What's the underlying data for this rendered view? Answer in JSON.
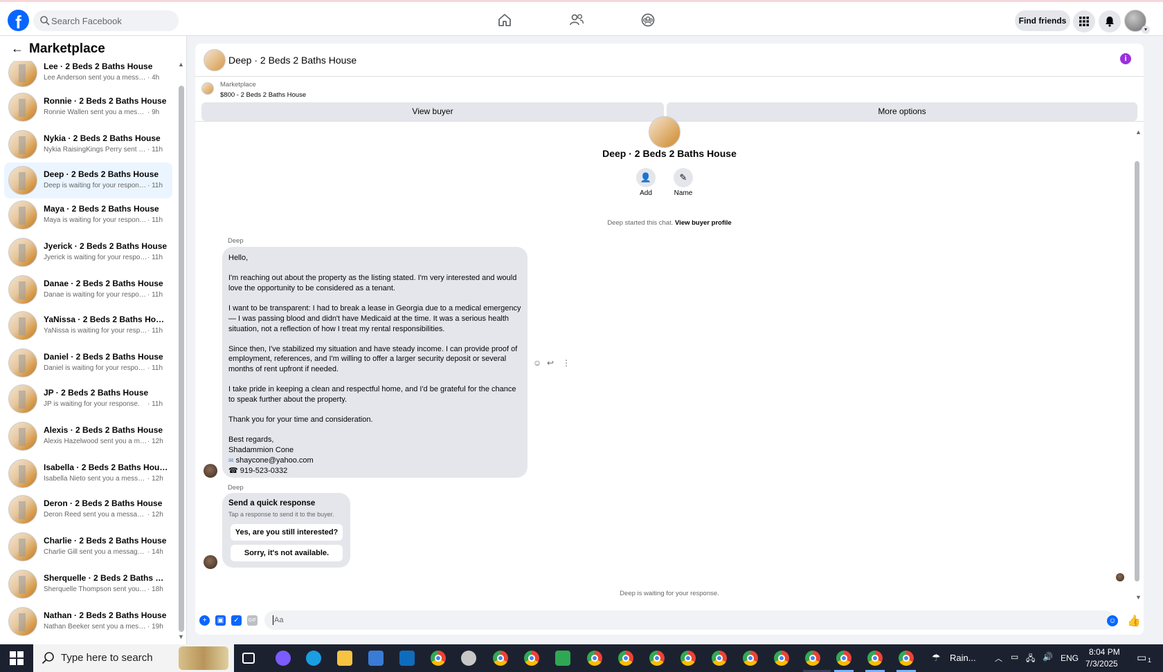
{
  "topnav": {
    "search_placeholder": "Search Facebook",
    "find_friends_label": "Find friends",
    "icons": [
      "home-icon",
      "friends-icon",
      "groups-icon",
      "apps-grid-icon",
      "notifications-bell-icon"
    ]
  },
  "sidebar": {
    "title": "Marketplace",
    "conversations": [
      {
        "title": "Lee · 2 Beds 2 Baths House",
        "preview": "Lee Anderson sent you a message ...",
        "time": "· 4h"
      },
      {
        "title": "Ronnie · 2 Beds 2 Baths House",
        "preview": "Ronnie Wallen sent you a message...",
        "time": "· 9h"
      },
      {
        "title": "Nykia · 2 Beds 2 Baths House",
        "preview": "Nykia RaisingKings Perry sent yo...",
        "time": "· 11h"
      },
      {
        "title": "Deep · 2 Beds 2 Baths House",
        "preview": "Deep is waiting for your response.",
        "time": "· 11h"
      },
      {
        "title": "Maya · 2 Beds 2 Baths House",
        "preview": "Maya is waiting for your response.",
        "time": "· 11h"
      },
      {
        "title": "Jyerick · 2 Beds 2 Baths House",
        "preview": "Jyerick is waiting for your respon...",
        "time": "· 11h"
      },
      {
        "title": "Danae · 2 Beds 2 Baths House",
        "preview": "Danae is waiting for your respon...",
        "time": "· 11h"
      },
      {
        "title": "YaNissa · 2 Beds 2 Baths House",
        "preview": "YaNissa is waiting for your respo...",
        "time": "· 11h"
      },
      {
        "title": "Daniel · 2 Beds 2 Baths House",
        "preview": "Daniel is waiting for your respon...",
        "time": "· 11h"
      },
      {
        "title": "JP · 2 Beds 2 Baths House",
        "preview": "JP is waiting for your response.",
        "time": "· 11h"
      },
      {
        "title": "Alexis · 2 Beds 2 Baths House",
        "preview": "Alexis Hazelwood sent you a mes...",
        "time": "· 12h"
      },
      {
        "title": "Isabella · 2 Beds 2 Baths House",
        "preview": "Isabella Nieto sent you a messag...",
        "time": "· 12h"
      },
      {
        "title": "Deron · 2 Beds 2 Baths House",
        "preview": "Deron Reed sent you a message ...",
        "time": "· 12h"
      },
      {
        "title": "Charlie · 2 Beds 2 Baths House",
        "preview": "Charlie Gill sent you a message a...",
        "time": "· 14h"
      },
      {
        "title": "Sherquelle · 2 Beds 2 Baths Hou...",
        "preview": "Sherquelle Thompson sent you a ...",
        "time": "· 18h"
      },
      {
        "title": "Nathan · 2 Beds 2 Baths House",
        "preview": "Nathan Beeker sent you a messa...",
        "time": "· 19h"
      }
    ],
    "selected_index": 3
  },
  "chat": {
    "title": "Deep · 2 Beds 2 Baths House",
    "listing_label": "Marketplace",
    "listing_price": "$800 - 2 Beds 2 Baths House",
    "view_buyer_label": "View buyer",
    "more_options_label": "More options",
    "profile_name": "Deep · 2 Beds 2 Baths House",
    "add_label": "Add",
    "name_label": "Name",
    "started_text": "Deep started this chat.",
    "view_profile_label": "View buyer profile",
    "sender_name": "Deep",
    "message": {
      "p1": "Hello,",
      "p2": "I'm reaching out about the property as the listing stated. I'm very interested and would love the opportunity to be considered as a tenant.",
      "p3": "I want to be transparent: I had to break a lease in Georgia due to a medical emergency — I was passing blood and didn't have Medicaid at the time. It was a serious health situation, not a reflection of how I treat my rental responsibilities.",
      "p4": "Since then, I've stabilized my situation and have steady income. I can provide proof of employment, references, and I'm willing to offer a larger security deposit or several months of rent upfront if needed.",
      "p5": "I take pride in keeping a clean and respectful home, and I'd be grateful for the chance to speak further about the property.",
      "p6": "Thank you for your time and consideration.",
      "sign1": "Best regards,",
      "sign2": "Shadammion Cone",
      "email": "shaycone@yahoo.com",
      "phone": "919-523-0332"
    },
    "quick_response": {
      "title": "Send a quick response",
      "subtitle": "Tap a response to send it to the buyer.",
      "option1": "Yes, are you still interested?",
      "option2": "Sorry, it's not available."
    },
    "waiting_text": "Deep is waiting for your response.",
    "composer_placeholder": "Aa",
    "composer_icons": [
      "plus-icon",
      "image-icon",
      "sticker-icon",
      "gif-icon",
      "emoji-icon",
      "like-icon"
    ],
    "gif_label": "GIF"
  },
  "taskbar": {
    "search_placeholder": "Type here to search",
    "weather_label": "Rain...",
    "language": "ENG",
    "time": "8:04 PM",
    "date": "7/3/2025",
    "notification_count": "1"
  },
  "colors": {
    "accent": "#0866ff",
    "selected_row": "#ebf5ff",
    "bubble": "#e4e6eb",
    "info": "#9b2fe0"
  }
}
